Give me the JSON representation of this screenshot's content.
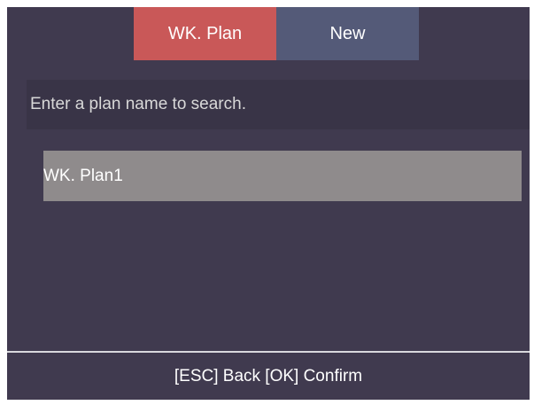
{
  "tabs": [
    {
      "label": "WK. Plan",
      "active": true
    },
    {
      "label": "New",
      "active": false
    }
  ],
  "search": {
    "placeholder": "Enter a plan name to search."
  },
  "plans": [
    {
      "name": "WK. Plan1",
      "selected": true
    }
  ],
  "footer": {
    "hint": "[ESC] Back [OK] Confirm"
  },
  "colors": {
    "background": "#403a4f",
    "active_tab": "#c95858",
    "inactive_tab": "#545a78",
    "selected_row": "#8f8b8c"
  }
}
